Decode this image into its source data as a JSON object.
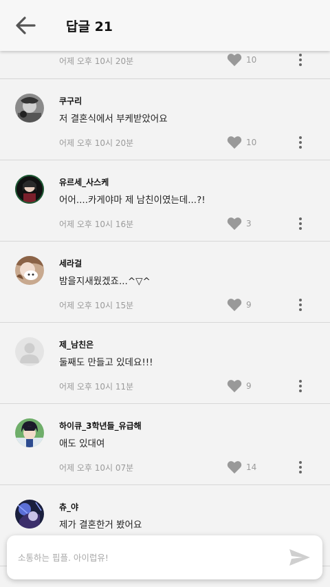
{
  "header": {
    "title": "답글 21",
    "back_icon": "arrow-left-icon"
  },
  "partial_comment": {
    "time": "어제 오후 10시 20분",
    "likes": "10"
  },
  "comments": [
    {
      "username": "쿠구리",
      "text": "저 결혼식에서 부케받았어요",
      "time": "어제 오후 10시 20분",
      "likes": "10"
    },
    {
      "username": "유르세_사스케",
      "text": "어어....카게야마 제 남친이였는데...?!",
      "time": "어제 오후 10시 16분",
      "likes": "3"
    },
    {
      "username": "세라걸",
      "text": "밤을지새웠겠죠...^▽^",
      "time": "어제 오후 10시 15분",
      "likes": "9"
    },
    {
      "username": "제_남친은",
      "text": "둘째도 만들고 있데요!!!",
      "time": "어제 오후 10시 11분",
      "likes": "9"
    },
    {
      "username": "하이큐_3학년들_유급해",
      "text": "애도 있대여",
      "time": "어제 오후 10시 07분",
      "likes": "14"
    },
    {
      "username": "츄_야",
      "text": "제가 결혼한거 봤어요",
      "time": "",
      "likes": ""
    }
  ],
  "input": {
    "placeholder": "소통하는 핍플. 아이럽유!",
    "value": ""
  },
  "colors": {
    "accent_grey": "#9a9a9a",
    "heart": "#999999",
    "background": "#f3f3f3"
  }
}
